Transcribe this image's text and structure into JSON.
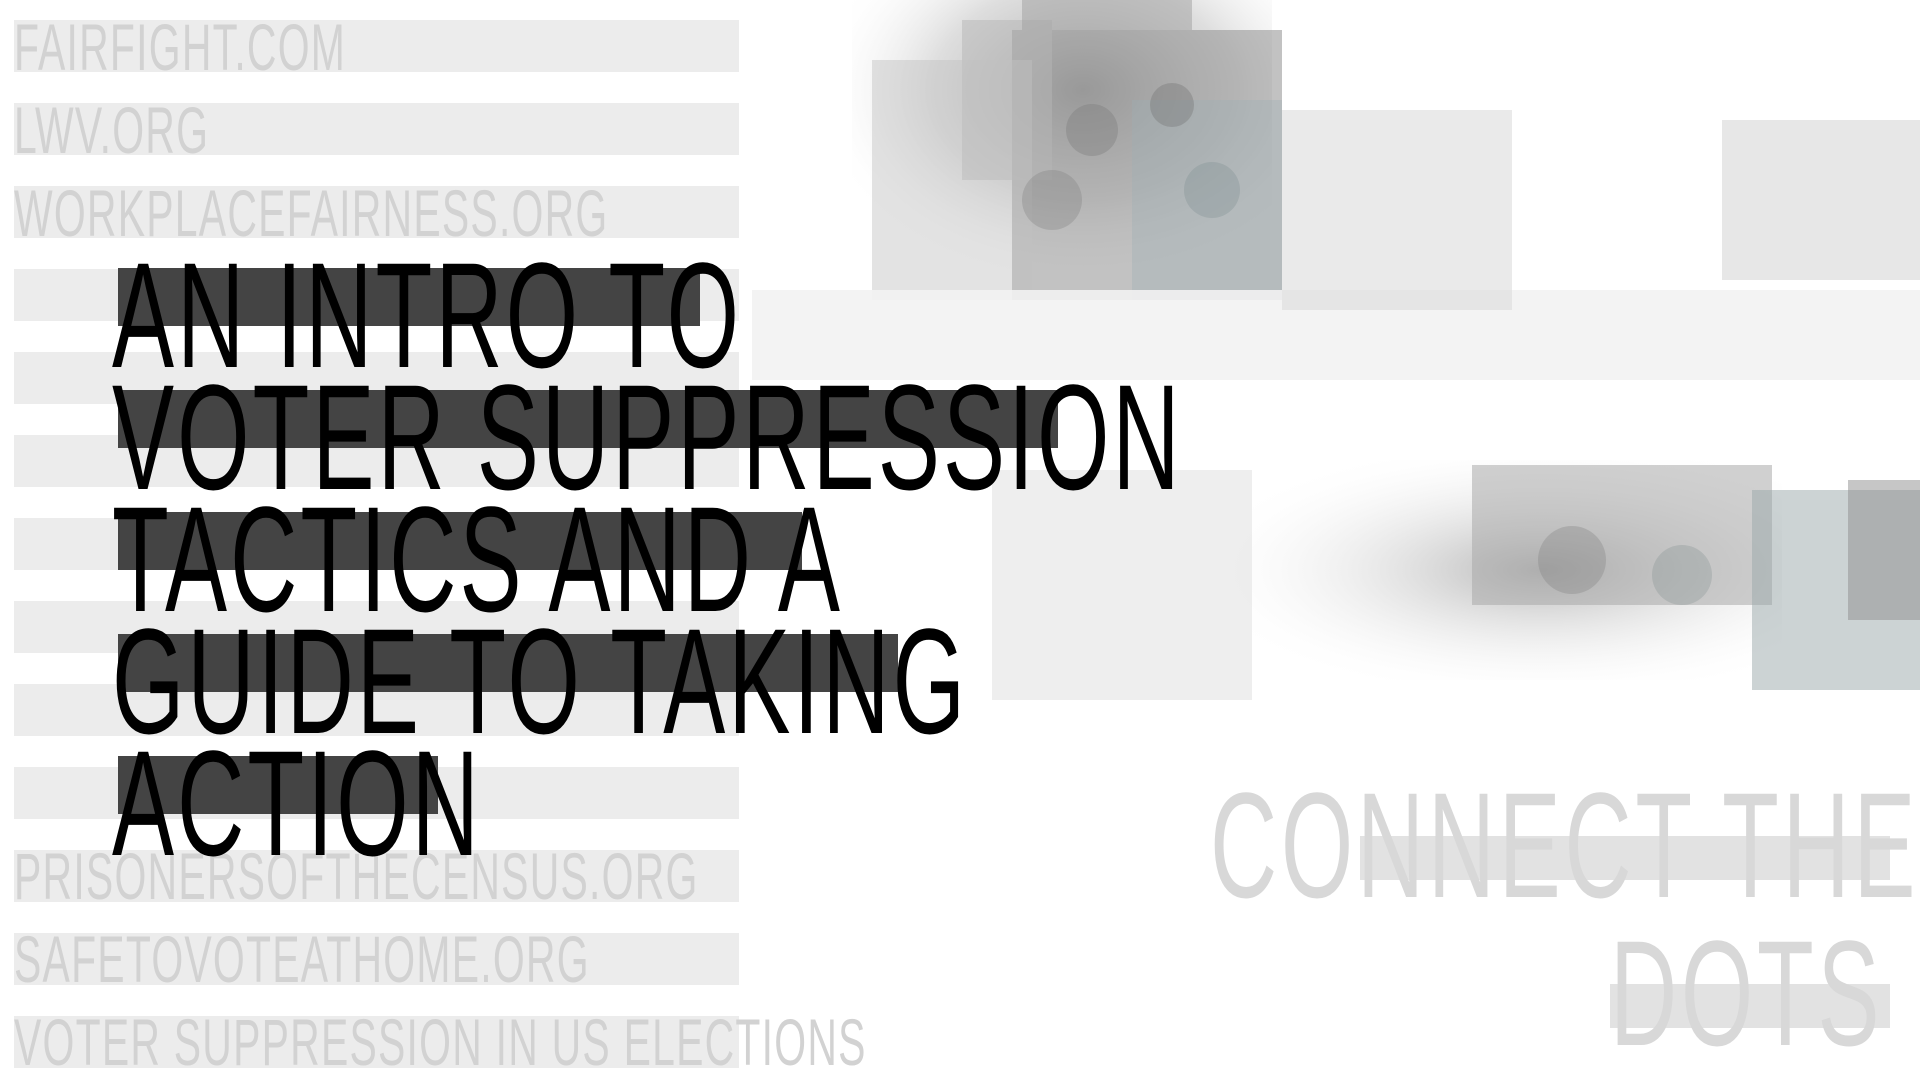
{
  "links": [
    "FAIRFIGHT.COM",
    "LWV.ORG",
    "WORKPLACEFAIRNESS.ORG",
    "PRISONERSOFTHECENSUS.ORG",
    "SAFETOVOTEATHOME.ORG",
    "VOTER SUPPRESSION IN US ELECTIONS"
  ],
  "headline": {
    "lines": [
      "AN INTRO TO",
      "VOTER SUPPRESSION",
      "TACTICS AND A",
      "GUIDE TO TAKING",
      "ACTION"
    ]
  },
  "tagline": {
    "line1": "CONNECT THE",
    "line2": "DOTS"
  },
  "colors": {
    "stripe": "#ececec",
    "headline_bar": "#444444",
    "muted_text": "#d2d2d2"
  }
}
